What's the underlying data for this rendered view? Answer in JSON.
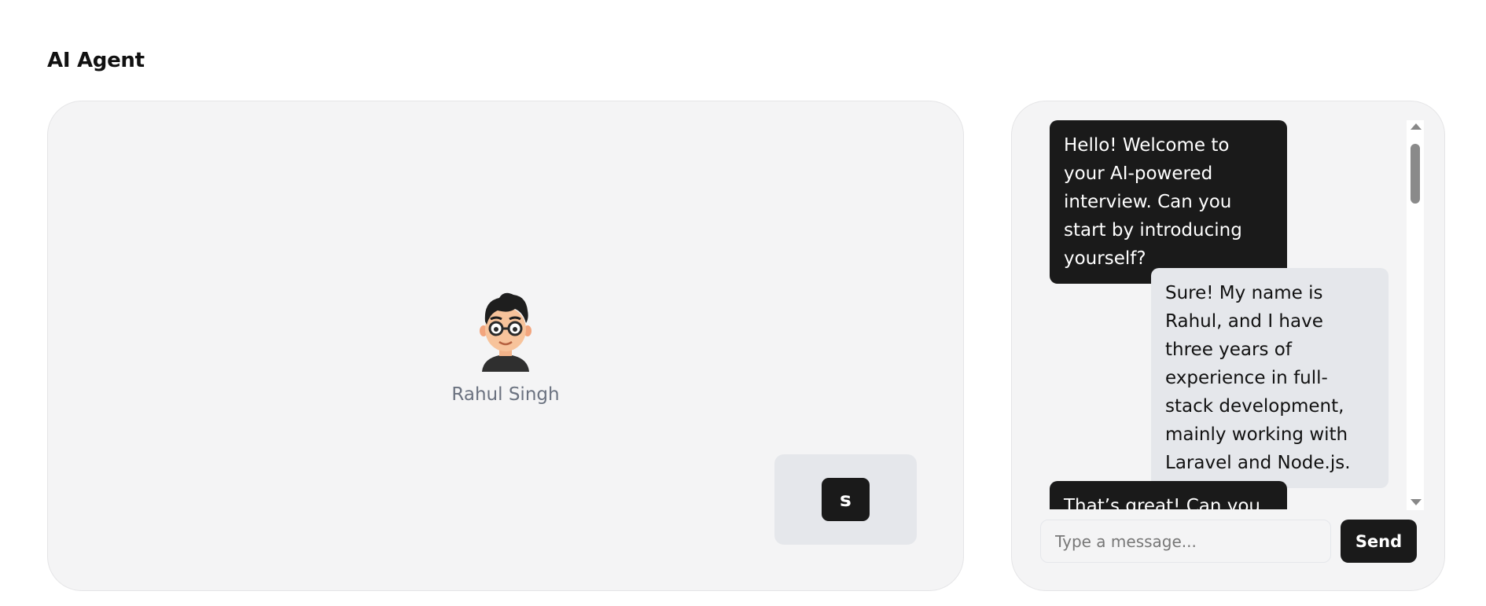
{
  "page": {
    "title": "AI Agent"
  },
  "stage": {
    "agent_name": "Rahul Singh",
    "self_initial": "s"
  },
  "chat": {
    "messages": [
      {
        "role": "ai",
        "text": "Hello! Welcome to your AI-powered interview. Can you start by introducing yourself?"
      },
      {
        "role": "user",
        "text": "Sure! My name is Rahul, and I have three years of experience in full-stack development, mainly working with Laravel and Node.js."
      },
      {
        "role": "ai",
        "text": "That’s great! Can you"
      }
    ],
    "input_placeholder": "Type a message...",
    "send_label": "Send"
  },
  "colors": {
    "ai_bubble": "#1a1a1a",
    "user_bubble": "#e5e7eb",
    "panel_bg": "#f4f4f5"
  }
}
